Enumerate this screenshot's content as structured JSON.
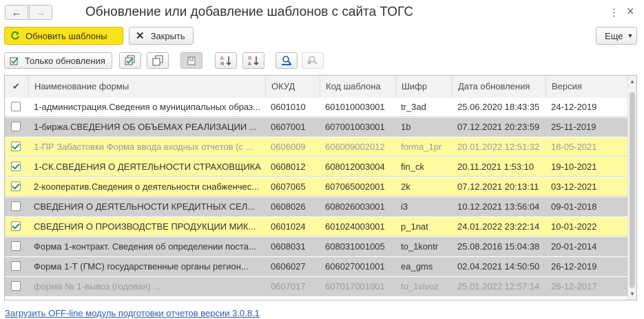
{
  "window": {
    "title": "Обновление или добавление шаблонов с сайта ТОГС",
    "more_icon": "⋮",
    "close_icon": "×"
  },
  "toolbar": {
    "update_label": "Обновить шаблоны",
    "close_label": "Закрыть",
    "more_label": "Еще"
  },
  "toolbar2": {
    "only_updates_label": "Только обновления"
  },
  "grid": {
    "columns": [
      "Наименование формы",
      "ОКУД",
      "Код шаблона",
      "Шифр",
      "Дата обновления",
      "Версия"
    ],
    "rows": [
      {
        "checked": false,
        "style": "white",
        "name": "1-администрация.Сведения о муниципальных образ...",
        "okud": "0601010",
        "code": "601010003001",
        "cipher": "tr_3ad",
        "date": "25.06.2020 18:43:35",
        "version": "24-12-2019"
      },
      {
        "checked": false,
        "style": "gray",
        "name": "1-биржа.СВЕДЕНИЯ ОБ ОБЪЕМАХ РЕАЛИЗАЦИИ ...",
        "okud": "0607001",
        "code": "607001003001",
        "cipher": "1b",
        "date": "07.12.2021 20:23:59",
        "version": "25-11-2019"
      },
      {
        "checked": true,
        "style": "yellow-dim",
        "name": "1-ПР Забастовки Форма ввода входных отчетов (с ...",
        "okud": "0606009",
        "code": "606009002012",
        "cipher": "forma_1pr",
        "date": "20.01.2022 12:51:32",
        "version": "18-05-2021"
      },
      {
        "checked": true,
        "style": "yellow",
        "name": "1-СК.СВЕДЕНИЯ О ДЕЯТЕЛЬНОСТИ СТРАХОВЩИКА",
        "okud": "0608012",
        "code": "608012003004",
        "cipher": "fin_ck",
        "date": "20.11.2021 1:53:10",
        "version": "19-10-2021"
      },
      {
        "checked": true,
        "style": "yellow",
        "name": "2-кооператив.Сведения о деятельности снабженчес...",
        "okud": "0607065",
        "code": "607065002001",
        "cipher": "2k",
        "date": "07.12.2021 20:13:11",
        "version": "03-12-2021"
      },
      {
        "checked": false,
        "style": "gray",
        "name": "СВЕДЕНИЯ О ДЕЯТЕЛЬНОСТИ КРЕДИТНЫХ СЕЛ...",
        "okud": "0608026",
        "code": "608026003001",
        "cipher": "i3",
        "date": "10.12.2021 13:56:04",
        "version": "09-01-2018"
      },
      {
        "checked": true,
        "style": "yellow",
        "name": "СВЕДЕНИЯ О ПРОИЗВОДСТВЕ ПРОДУКЦИИ МИК...",
        "okud": "0601024",
        "code": "601024003001",
        "cipher": "p_1nat",
        "date": "24.01.2022 23:22:14",
        "version": "10-01-2022"
      },
      {
        "checked": false,
        "style": "gray",
        "name": "Форма 1-контракт. Сведения об определении поста...",
        "okud": "0608031",
        "code": "608031001005",
        "cipher": "to_1kontr",
        "date": "25.08.2016 15:04:38",
        "version": "20-01-2014"
      },
      {
        "checked": false,
        "style": "gray",
        "name": "Форма 1-Т (ГМС)  государственные органы регион...",
        "okud": "0606027",
        "code": "606027001001",
        "cipher": "ea_gms",
        "date": "02.04.2021 14:50:50",
        "version": "26-12-2019"
      },
      {
        "checked": false,
        "style": "gray-dim",
        "name": "форма №  1-вывоз (годовая)      ...",
        "okud": "0607017",
        "code": "607017001001",
        "cipher": "to_1vivoz",
        "date": "25.01.2022 12:57:14",
        "version": "26-12-2017"
      }
    ]
  },
  "footer": {
    "link_label": "Загрузить OFF-line модуль подготовки отчетов версии 3.0.8.1"
  },
  "colors": {
    "primary_button": "#fbe31b",
    "row_yellow": "#fdfaa0",
    "row_gray": "#d0d0d0",
    "link": "#2a5fad",
    "check": "#2a9a2a"
  }
}
